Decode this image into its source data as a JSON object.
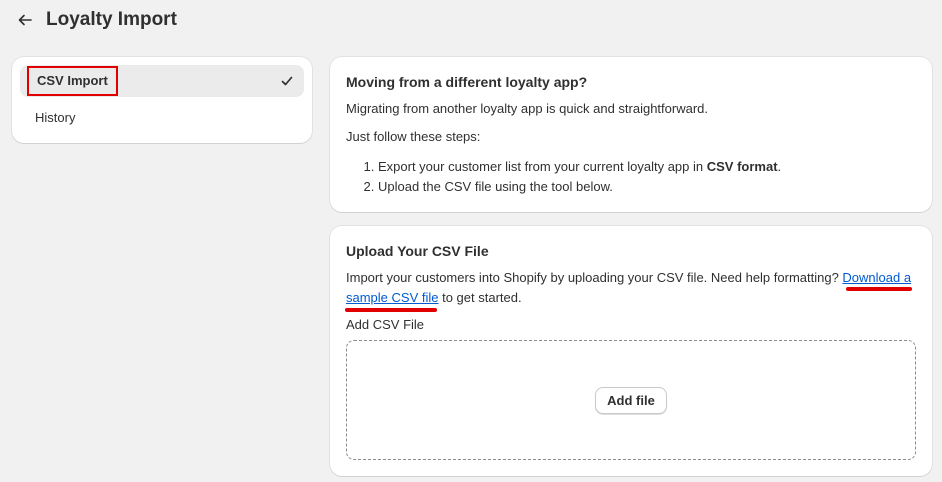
{
  "header": {
    "back_icon": "arrow-left-icon",
    "title": "Loyalty Import"
  },
  "nav": {
    "items": [
      {
        "label": "CSV Import",
        "active": true,
        "check_icon": "checkmark-icon"
      },
      {
        "label": "History",
        "active": false
      }
    ]
  },
  "migration_card": {
    "title": "Moving from a different loyalty app?",
    "intro": "Migrating from another loyalty app is quick and straightforward.",
    "steps_intro": "Just follow these steps:",
    "step1_prefix": "Export your customer list from your current loyalty app in ",
    "step1_bold": "CSV format",
    "step1_suffix": ".",
    "step2": "Upload the CSV file using the tool below."
  },
  "upload_card": {
    "title": "Upload Your CSV File",
    "desc_prefix": "Import your customers into Shopify by uploading your CSV file. Need help formatting? ",
    "link_text": "Download a sample CSV file",
    "desc_suffix": " to get started.",
    "field_label": "Add CSV File",
    "add_button": "Add file"
  },
  "colors": {
    "accent_link": "#005bd3",
    "highlight_red": "#e00000",
    "background": "#f1f1f1"
  }
}
